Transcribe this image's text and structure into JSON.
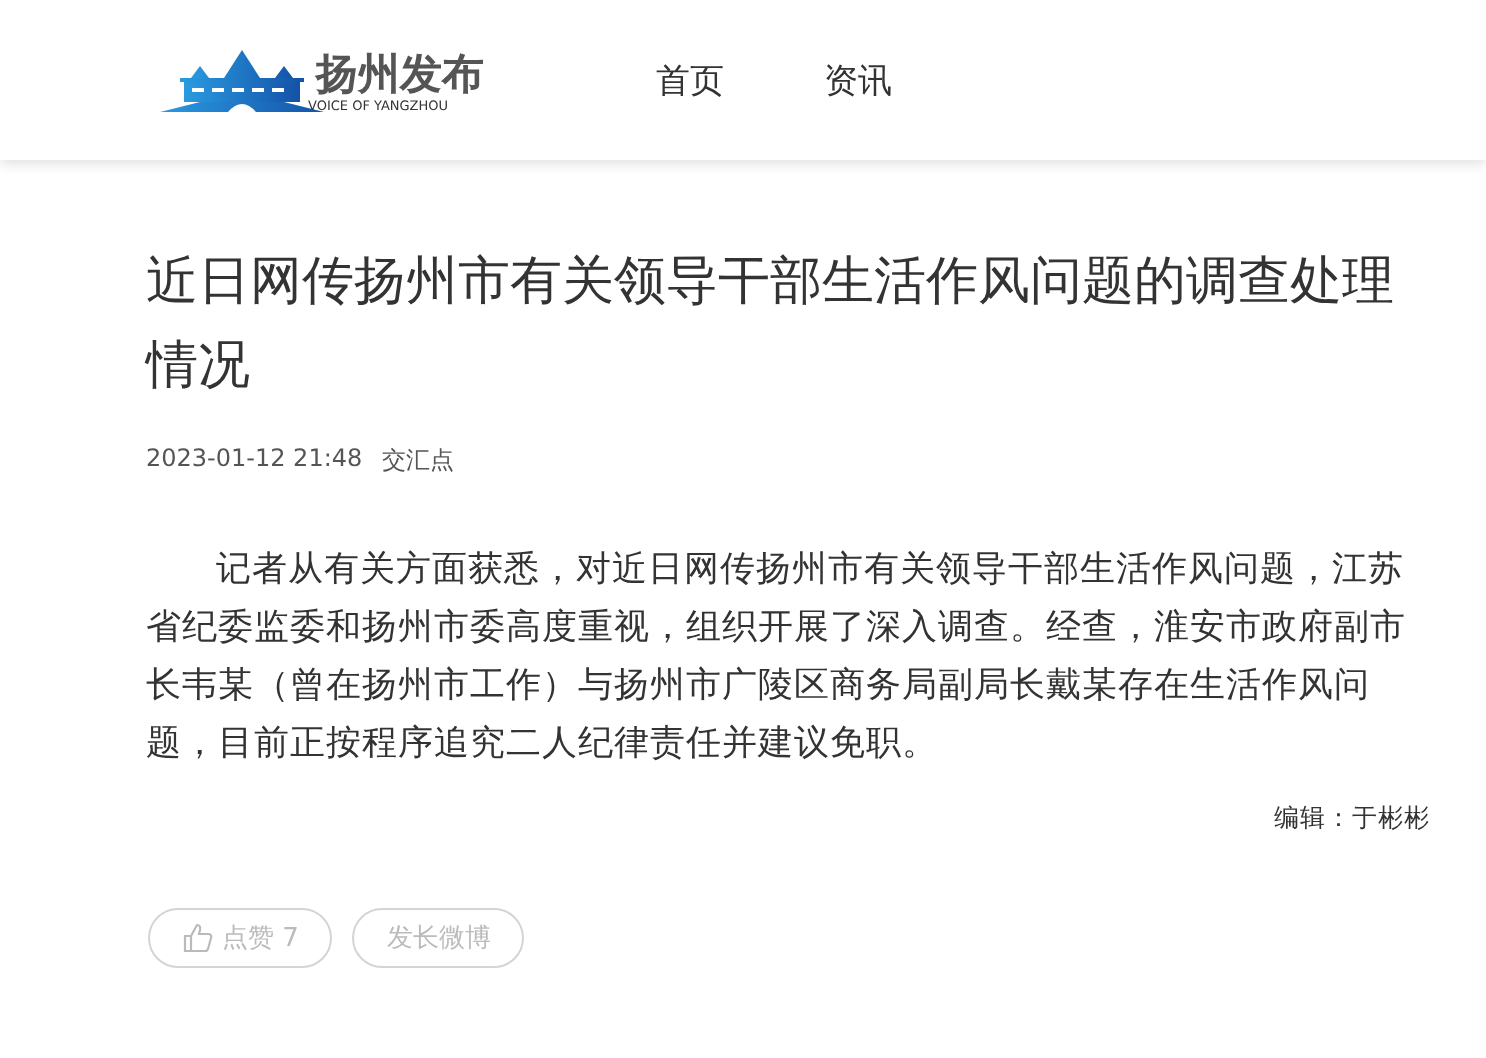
{
  "header": {
    "logo_title": "扬州发布",
    "logo_subtitle": "VOICE OF YANGZHOU",
    "nav": [
      {
        "label": "首页",
        "selected": false
      },
      {
        "label": "资讯",
        "selected": false
      }
    ]
  },
  "article": {
    "title": "近日网传扬州市有关领导干部生活作风问题的调查处理情况",
    "date": "2023-01-12 21:48",
    "source": "交汇点",
    "body": "记者从有关方面获悉，对近日网传扬州市有关领导干部生活作风问题，江苏省纪委监委和扬州市委高度重视，组织开展了深入调查。经查，淮安市政府副市长韦某（曾在扬州市工作）与扬州市广陵区商务局副局长戴某存在生活作风问题，目前正按程序追究二人纪律责任并建议免职。",
    "editor": "编辑：于彬彬"
  },
  "actions": [
    {
      "kind": "like",
      "label": "点赞 7"
    },
    {
      "kind": "share",
      "label": "发长微博"
    }
  ]
}
